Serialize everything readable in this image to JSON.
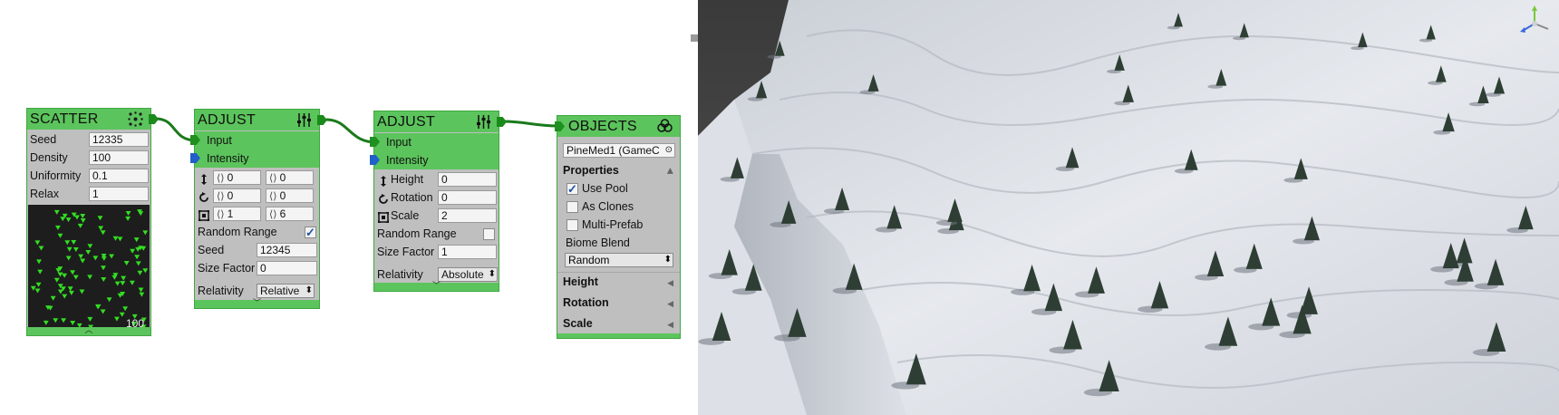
{
  "scatter": {
    "title": "SCATTER",
    "icon": "scatter-icon",
    "seed_label": "Seed",
    "seed_value": "12335",
    "density_label": "Density",
    "density_value": "100",
    "uniformity_label": "Uniformity",
    "uniformity_value": "0.1",
    "relax_label": "Relax",
    "relax_value": "1",
    "preview_count": "100"
  },
  "adjust1": {
    "title": "ADJUST",
    "icon": "sliders-icon",
    "input_label": "Input",
    "intensity_label": "Intensity",
    "height_min": "0",
    "height_max": "0",
    "rotation_min": "0",
    "rotation_max": "0",
    "scale_min": "1",
    "scale_max": "6",
    "random_range_label": "Random Range",
    "random_range_checked": true,
    "seed_label": "Seed",
    "seed_value": "12345",
    "size_factor_label": "Size Factor",
    "size_factor_value": "0",
    "relativity_label": "Relativity",
    "relativity_value": "Relative"
  },
  "adjust2": {
    "title": "ADJUST",
    "icon": "sliders-icon",
    "input_label": "Input",
    "intensity_label": "Intensity",
    "height_label": "Height",
    "height_value": "0",
    "rotation_label": "Rotation",
    "rotation_value": "0",
    "scale_label": "Scale",
    "scale_value": "2",
    "random_range_label": "Random Range",
    "random_range_checked": false,
    "size_factor_label": "Size Factor",
    "size_factor_value": "1",
    "relativity_label": "Relativity",
    "relativity_value": "Absolute"
  },
  "objects": {
    "title": "OBJECTS",
    "icon": "objects-icon",
    "object_field": "PineMed1 (GameC",
    "properties_label": "Properties",
    "use_pool_label": "Use Pool",
    "use_pool_checked": true,
    "as_clones_label": "As Clones",
    "as_clones_checked": false,
    "multi_prefab_label": "Multi-Prefab",
    "multi_prefab_checked": false,
    "biome_blend_label": "Biome Blend",
    "biome_blend_value": "Random",
    "height_label": "Height",
    "rotation_label": "Rotation",
    "scale_label": "Scale"
  },
  "colors": {
    "node_header": "#5cc45c",
    "node_body": "#bfbfbf",
    "wire": "#1a8a1a",
    "intensity_port": "#2060c8"
  }
}
